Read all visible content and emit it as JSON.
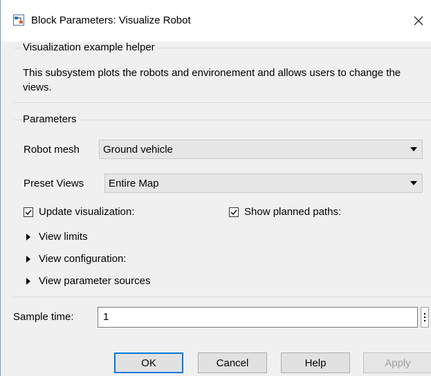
{
  "window": {
    "title": "Block Parameters: Visualize Robot",
    "close_icon": "close-icon"
  },
  "description": {
    "heading": "Visualization example helper",
    "text": "This subsystem plots the robots and environement and allows users to change the views."
  },
  "parameters": {
    "heading": "Parameters",
    "robot_mesh": {
      "label": "Robot mesh",
      "value": "Ground vehicle"
    },
    "preset_views": {
      "label": "Preset Views",
      "value": "Entire Map"
    },
    "update_visualization": {
      "label": "Update visualization:",
      "checked": true
    },
    "show_planned_paths": {
      "label": "Show planned paths:",
      "checked": true
    },
    "sections": [
      {
        "label": "View limits"
      },
      {
        "label": "View configuration:"
      },
      {
        "label": "View parameter sources"
      }
    ]
  },
  "sample_time": {
    "label": "Sample time:",
    "value": "1"
  },
  "buttons": {
    "ok": "OK",
    "cancel": "Cancel",
    "help": "Help",
    "apply": "Apply"
  },
  "colors": {
    "accent": "#0078d7",
    "window_bg": "#f0f0f0"
  }
}
